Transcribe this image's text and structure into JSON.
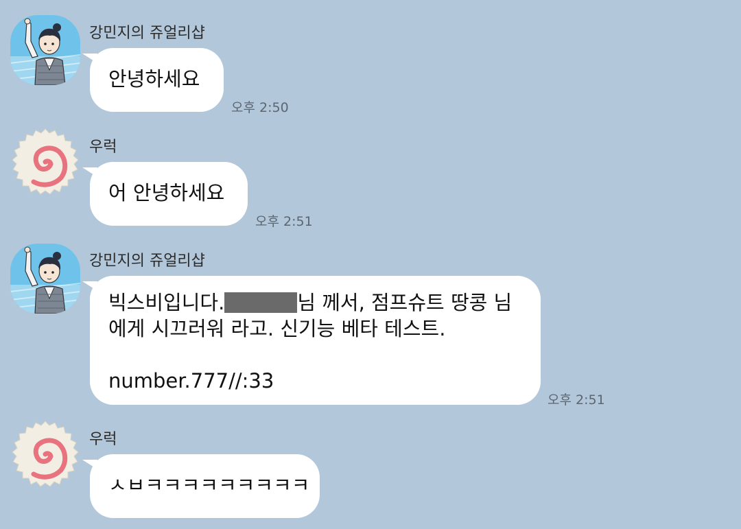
{
  "messages": [
    {
      "sender": "강민지의 쥬얼리샵",
      "avatar": "boy-character-avatar",
      "text": "안녕하세요",
      "time": "오후 2:50"
    },
    {
      "sender": "우럭",
      "avatar": "narutomaki-avatar",
      "text": "어 안녕하세요",
      "time": "오후 2:51"
    },
    {
      "sender": "강민지의 쥬얼리샵",
      "avatar": "boy-character-avatar",
      "text_line1_before": "빅스비입니다.",
      "text_line1_after": "님 께서, 점프슈트 땅콩 님",
      "text_line2": "에게 시끄러워 라고. 신기능 베타 테스트.",
      "text_line3": "number.777//:33",
      "time": "오후 2:51"
    },
    {
      "sender": "우럭",
      "avatar": "narutomaki-avatar",
      "text": "ㅅㅂㅋㅋㅋㅋㅋㅋㅋㅋㅋ"
    }
  ],
  "colors": {
    "background": "#b2c7da",
    "bubble": "#ffffff",
    "time_text": "#5b6670",
    "redaction": "#6a6a6a"
  }
}
